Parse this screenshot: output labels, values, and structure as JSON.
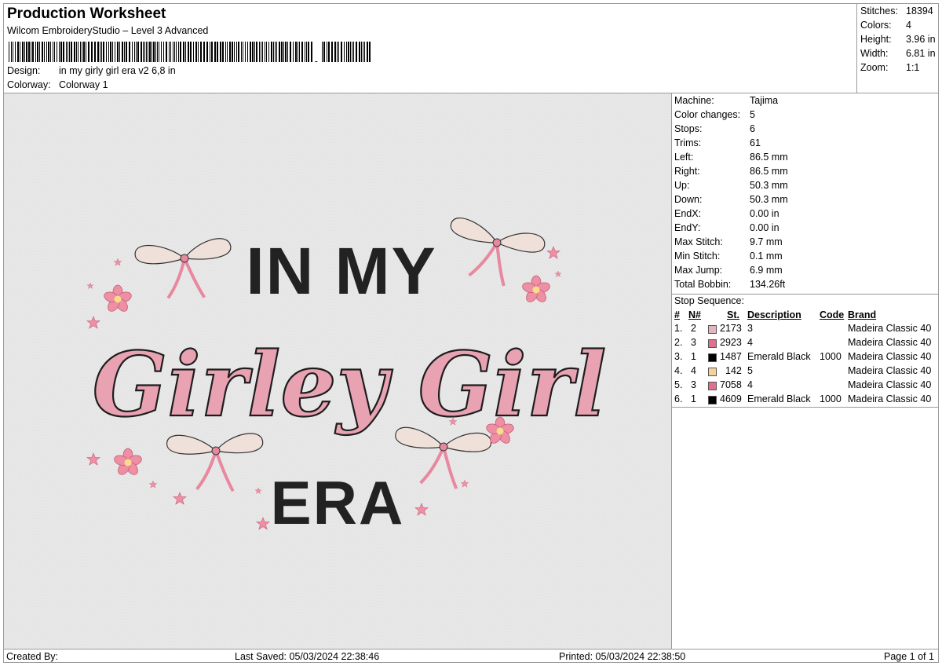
{
  "header": {
    "title": "Production Worksheet",
    "software": "Wilcom EmbroideryStudio – Level 3 Advanced",
    "design_label": "Design:",
    "design_value": "in my girly girl era  v2 6,8 in",
    "colorway_label": "Colorway:",
    "colorway_value": "Colorway 1"
  },
  "summary": [
    {
      "label": "Stitches:",
      "value": "18394"
    },
    {
      "label": "Colors:",
      "value": "4"
    },
    {
      "label": "Height:",
      "value": "3.96 in"
    },
    {
      "label": "Width:",
      "value": "6.81 in"
    },
    {
      "label": "Zoom:",
      "value": "1:1"
    }
  ],
  "specs": [
    {
      "label": "Machine:",
      "value": "Tajima"
    },
    {
      "label": "Color changes:",
      "value": "5"
    },
    {
      "label": "Stops:",
      "value": "6"
    },
    {
      "label": "Trims:",
      "value": "61"
    },
    {
      "label": "Left:",
      "value": "86.5 mm"
    },
    {
      "label": "Right:",
      "value": "86.5 mm"
    },
    {
      "label": "Up:",
      "value": "50.3 mm"
    },
    {
      "label": "Down:",
      "value": "50.3 mm"
    },
    {
      "label": "EndX:",
      "value": "0.00 in"
    },
    {
      "label": "EndY:",
      "value": "0.00 in"
    },
    {
      "label": "Max Stitch:",
      "value": "9.7 mm"
    },
    {
      "label": "Min Stitch:",
      "value": "0.1 mm"
    },
    {
      "label": "Max Jump:",
      "value": "6.9 mm"
    },
    {
      "label": "Total Bobbin:",
      "value": "134.26ft"
    }
  ],
  "stop_sequence": {
    "title": "Stop Sequence:",
    "headers": {
      "num": "#",
      "n": "N#",
      "st": "St.",
      "description": "Description",
      "code": "Code",
      "brand": "Brand"
    },
    "rows": [
      {
        "num": "1.",
        "n": "2",
        "color": "#e3b6bd",
        "st": "2173",
        "description": "3",
        "code": "",
        "brand": "Madeira Classic 40"
      },
      {
        "num": "2.",
        "n": "3",
        "color": "#e0708f",
        "st": "2923",
        "description": "4",
        "code": "",
        "brand": "Madeira Classic 40"
      },
      {
        "num": "3.",
        "n": "1",
        "color": "#000000",
        "st": "1487",
        "description": "Emerald Black",
        "code": "1000",
        "brand": "Madeira Classic 40"
      },
      {
        "num": "4.",
        "n": "4",
        "color": "#f6d29a",
        "st": "142",
        "description": "5",
        "code": "",
        "brand": "Madeira Classic 40"
      },
      {
        "num": "5.",
        "n": "3",
        "color": "#e0708f",
        "st": "7058",
        "description": "4",
        "code": "",
        "brand": "Madeira Classic 40"
      },
      {
        "num": "6.",
        "n": "1",
        "color": "#000000",
        "st": "4609",
        "description": "Emerald Black",
        "code": "1000",
        "brand": "Madeira Classic 40"
      }
    ]
  },
  "design_text": {
    "line1": "IN MY",
    "line2": "Girley Girl",
    "line3": "ERA"
  },
  "footer": {
    "created_by": "Created By:",
    "last_saved": "Last Saved: 05/03/2024 22:38:46",
    "printed": "Printed: 05/03/2024 22:38:50",
    "page": "Page 1 of 1"
  },
  "colors": {
    "fabric": "#e9e9e9",
    "pink": "#e8a2b2",
    "pink_outline": "#1d1d1d",
    "black_thread": "#222222",
    "bow_cream": "#efe1d9",
    "bow_pink": "#e7889f",
    "flower_pink": "#ee8fa4",
    "flower_center": "#f7dc8a"
  }
}
